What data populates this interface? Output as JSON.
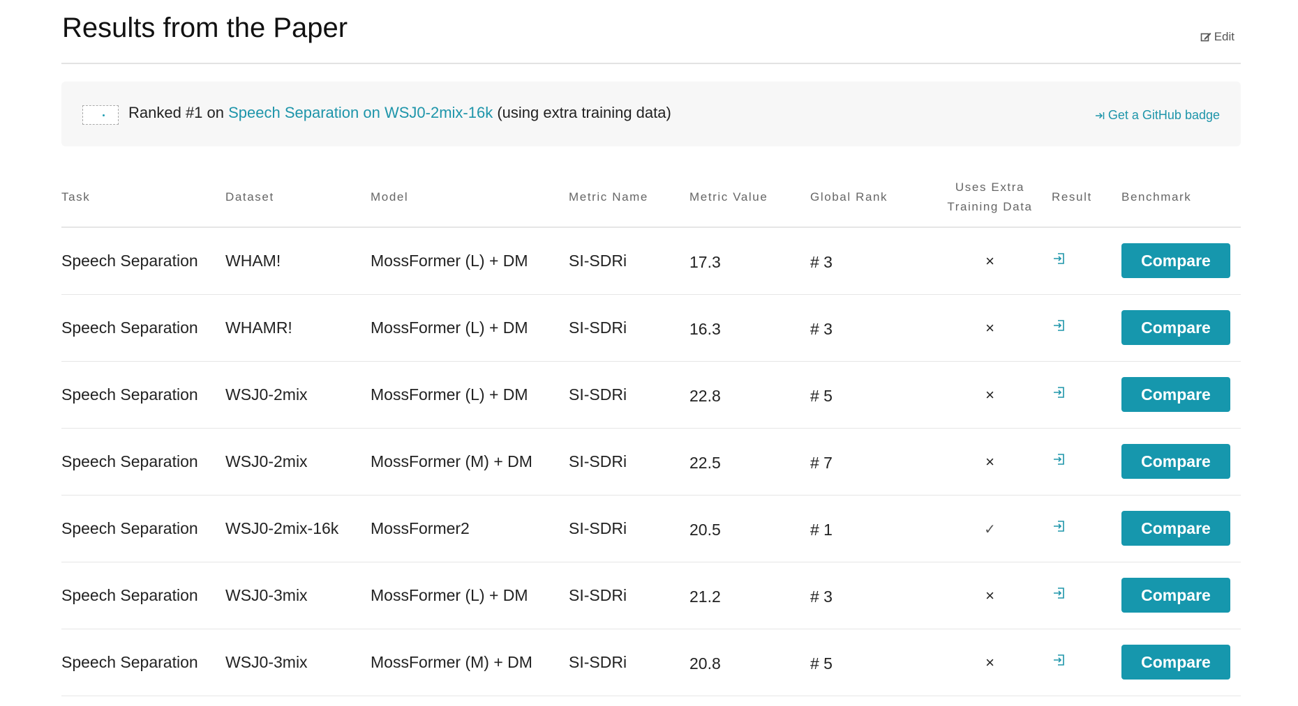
{
  "header": {
    "title": "Results from the Paper",
    "edit_label": "Edit"
  },
  "rank_banner": {
    "prefix": "Ranked #1 on",
    "benchmark_link": "Speech Separation on WSJ0-2mix-16k",
    "suffix": "(using extra training data)",
    "github_badge_label": "Get a GitHub badge"
  },
  "table": {
    "columns": {
      "task": "Task",
      "dataset": "Dataset",
      "model": "Model",
      "metric_name": "Metric Name",
      "metric_value": "Metric Value",
      "global_rank": "Global Rank",
      "extra_data_line1": "Uses Extra",
      "extra_data_line2": "Training Data",
      "result": "Result",
      "benchmark": "Benchmark"
    },
    "compare_label": "Compare",
    "rows": [
      {
        "task": "Speech Separation",
        "dataset": "WHAM!",
        "model": "MossFormer (L) + DM",
        "metric_name": "SI-SDRi",
        "metric_value": "17.3",
        "rank": "# 3",
        "extra": "×"
      },
      {
        "task": "Speech Separation",
        "dataset": "WHAMR!",
        "model": "MossFormer (L) + DM",
        "metric_name": "SI-SDRi",
        "metric_value": "16.3",
        "rank": "# 3",
        "extra": "×"
      },
      {
        "task": "Speech Separation",
        "dataset": "WSJ0-2mix",
        "model": "MossFormer (L) + DM",
        "metric_name": "SI-SDRi",
        "metric_value": "22.8",
        "rank": "# 5",
        "extra": "×"
      },
      {
        "task": "Speech Separation",
        "dataset": "WSJ0-2mix",
        "model": "MossFormer (M) + DM",
        "metric_name": "SI-SDRi",
        "metric_value": "22.5",
        "rank": "# 7",
        "extra": "×"
      },
      {
        "task": "Speech Separation",
        "dataset": "WSJ0-2mix-16k",
        "model": "MossFormer2",
        "metric_name": "SI-SDRi",
        "metric_value": "20.5",
        "rank": "# 1",
        "extra": "✓"
      },
      {
        "task": "Speech Separation",
        "dataset": "WSJ0-3mix",
        "model": "MossFormer (L) + DM",
        "metric_name": "SI-SDRi",
        "metric_value": "21.2",
        "rank": "# 3",
        "extra": "×"
      },
      {
        "task": "Speech Separation",
        "dataset": "WSJ0-3mix",
        "model": "MossFormer (M) + DM",
        "metric_name": "SI-SDRi",
        "metric_value": "20.8",
        "rank": "# 5",
        "extra": "×"
      }
    ]
  },
  "colors": {
    "accent": "#1697ad",
    "link": "#1e95aa"
  },
  "icons": {
    "edit": "edit-icon",
    "github_badge": "arrow-to-right-icon",
    "result": "sign-in-icon"
  }
}
